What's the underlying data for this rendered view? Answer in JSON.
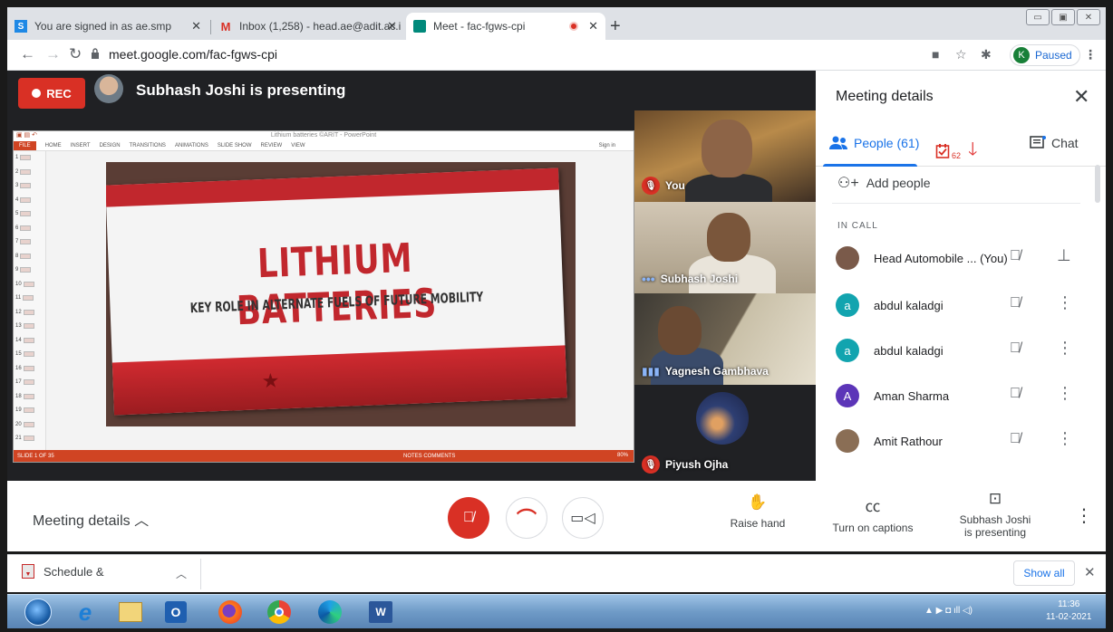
{
  "browser": {
    "tabs": [
      {
        "title": "You are signed in as ae.smp",
        "favicon": "S"
      },
      {
        "title": "Inbox (1,258) - head.ae@adit.ac.i",
        "favicon": "M"
      },
      {
        "title": "Meet - fac-fgws-cpi",
        "favicon": "meet-icon"
      }
    ],
    "url": "meet.google.com/fac-fgws-cpi",
    "profile_initial": "K",
    "profile_status": "Paused"
  },
  "meet": {
    "rec_label": "REC",
    "presenting_text": "Subhash Joshi is presenting",
    "slide": {
      "window_title": "Lithium batteries ©ARIT - PowerPoint",
      "ribbon_tabs": [
        "FILE",
        "HOME",
        "INSERT",
        "DESIGN",
        "TRANSITIONS",
        "ANIMATIONS",
        "SLIDE SHOW",
        "REVIEW",
        "VIEW"
      ],
      "sign_in": "Sign in",
      "title": "LITHIUM BATTERIES",
      "subtitle": "KEY ROLE IN ALTERNATE FUELS OF FUTURE MOBILITY",
      "status_left": "SLIDE 1 OF 35",
      "status_right": "NOTES   COMMENTS",
      "zoom": "80%",
      "thumbnail_numbers": [
        "1",
        "2",
        "3",
        "4",
        "5",
        "6",
        "7",
        "8",
        "9",
        "10",
        "11",
        "12",
        "13",
        "14",
        "15",
        "16",
        "17",
        "18",
        "19",
        "20",
        "21"
      ]
    },
    "tiles": [
      {
        "name": "You",
        "muted": true
      },
      {
        "name": "Subhash Joshi",
        "muted": false
      },
      {
        "name": "Yagnesh Gambhava",
        "muted": false
      },
      {
        "name": "Piyush Ojha",
        "muted": true
      }
    ]
  },
  "panel": {
    "title": "Meeting details",
    "tabs": {
      "people": "People (61)",
      "tasks_count": "62",
      "chat": "Chat"
    },
    "add_people": "Add people",
    "section": "IN CALL",
    "people": [
      {
        "name": "Head Automobile ... (You)",
        "initial": "",
        "color": "#7a5a4a"
      },
      {
        "name": "abdul kaladgi",
        "initial": "a",
        "color": "#12a4af"
      },
      {
        "name": "abdul kaladgi",
        "initial": "a",
        "color": "#12a4af"
      },
      {
        "name": "Aman Sharma",
        "initial": "A",
        "color": "#5c35b8"
      },
      {
        "name": "Amit Rathour",
        "initial": "",
        "color": "#8a6e55"
      }
    ]
  },
  "bottom": {
    "meeting_details": "Meeting details",
    "raise_hand": "Raise hand",
    "captions": "Turn on captions",
    "presenting_line1": "Subhash Joshi",
    "presenting_line2": "is presenting"
  },
  "downloads": {
    "file": "Schedule &",
    "show_all": "Show all"
  },
  "taskbar": {
    "time": "11:36",
    "date": "11-02-2021"
  }
}
